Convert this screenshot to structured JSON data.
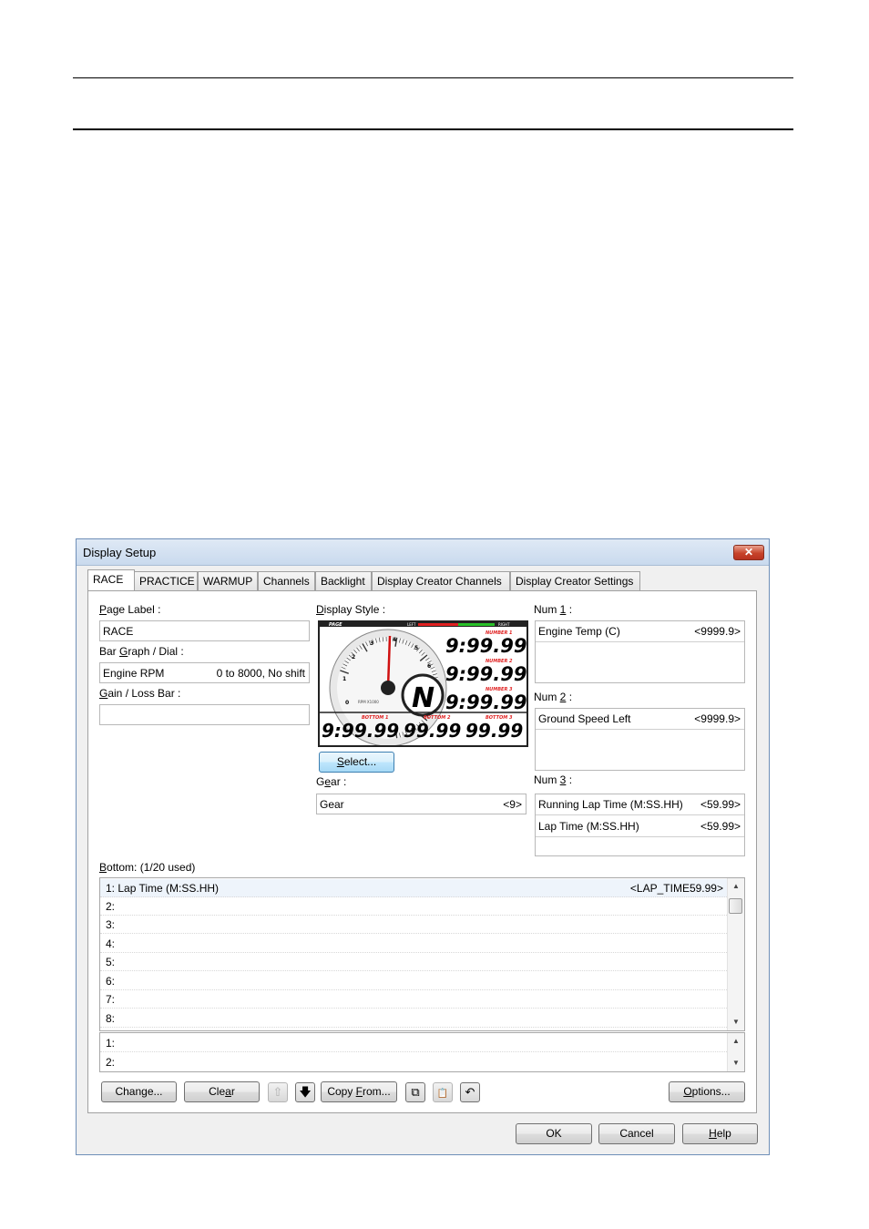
{
  "window": {
    "title": "Display Setup",
    "close_glyph": "✕"
  },
  "tabs": [
    "RACE",
    "PRACTICE",
    "WARMUP",
    "Channels",
    "Backlight",
    "Display Creator Channels",
    "Display Creator Settings"
  ],
  "left": {
    "page_label": {
      "pre": "",
      "key": "P",
      "post": "age Label :",
      "value": "RACE"
    },
    "bar_graph": {
      "pre": "Bar ",
      "key": "G",
      "post": "raph / Dial :",
      "name": "Engine RPM",
      "range": "0 to 8000, No shift"
    },
    "gain_loss": {
      "pre": "",
      "key": "G",
      "post": "ain / Loss Bar :",
      "value": ""
    }
  },
  "display_style": {
    "label_pre": "",
    "label_key": "D",
    "label_post": "isplay Style :",
    "preview": {
      "page": "PAGE",
      "left": "LEFT",
      "right": "RIGHT",
      "num1_tag": "NUMBER 1",
      "num2_tag": "NUMBER 2",
      "num3_tag": "NUMBER 3",
      "num1": "9:99.99",
      "num2": "9:99.99",
      "num3": "9:99.99",
      "rpm_label": "RPM X1000",
      "gear": "N",
      "bottom1_tag": "BOTTOM 1",
      "bottom2_tag": "BOTTOM 2",
      "bottom3_tag": "BOTTOM 3",
      "bottom1": "9:99.99",
      "bottom2": "99.99",
      "bottom3": "99.99",
      "dial_numbers": [
        "0",
        "1",
        "2",
        "3",
        "4",
        "5",
        "6"
      ]
    },
    "select_button": {
      "key": "S",
      "rest": "elect..."
    }
  },
  "gear": {
    "label_pre": "G",
    "label_key": "e",
    "label_post": "ar :",
    "name": "Gear",
    "value": "<9>"
  },
  "num1": {
    "label_pre": "Num ",
    "label_key": "1",
    "label_post": " :",
    "name": "Engine Temp (C)",
    "value": "<9999.9>"
  },
  "num2": {
    "label_pre": "Num ",
    "label_key": "2",
    "label_post": " :",
    "name": "Ground Speed Left",
    "value": "<9999.9>"
  },
  "num3": {
    "label_pre": "Num ",
    "label_key": "3",
    "label_post": " :",
    "rows": [
      {
        "name": "Running Lap Time (M:SS.HH)",
        "value": "<59.99>"
      },
      {
        "name": "Lap Time (M:SS.HH)",
        "value": "<59.99>"
      }
    ]
  },
  "bottom": {
    "label_pre": "",
    "label_key": "B",
    "label_post": "ottom: (1/20 used)",
    "rows": [
      {
        "n": "1:",
        "name": "Lap Time (M:SS.HH)",
        "value": "<LAP_TIME59.99>"
      },
      {
        "n": "2:",
        "name": "",
        "value": ""
      },
      {
        "n": "3:",
        "name": "",
        "value": ""
      },
      {
        "n": "4:",
        "name": "",
        "value": ""
      },
      {
        "n": "5:",
        "name": "",
        "value": ""
      },
      {
        "n": "6:",
        "name": "",
        "value": ""
      },
      {
        "n": "7:",
        "name": "",
        "value": ""
      },
      {
        "n": "8:",
        "name": "",
        "value": ""
      }
    ],
    "sub_rows": [
      {
        "n": "1:"
      },
      {
        "n": "2:"
      }
    ]
  },
  "toolbar": {
    "change": {
      "pre": "Chan",
      "key": "g",
      "post": "e..."
    },
    "clear": {
      "pre": "Cle",
      "key": "a",
      "post": "r"
    },
    "copy_from": {
      "pre": "Copy ",
      "key": "F",
      "post": "rom..."
    },
    "options": {
      "pre": "",
      "key": "O",
      "post": "ptions..."
    },
    "icons": {
      "up": "⇧",
      "down": "🡇",
      "copy": "⧉",
      "paste": "📋",
      "undo": "↶"
    }
  },
  "dialog_buttons": {
    "ok": "OK",
    "cancel": "Cancel",
    "help": {
      "key": "H",
      "rest": "elp"
    }
  }
}
